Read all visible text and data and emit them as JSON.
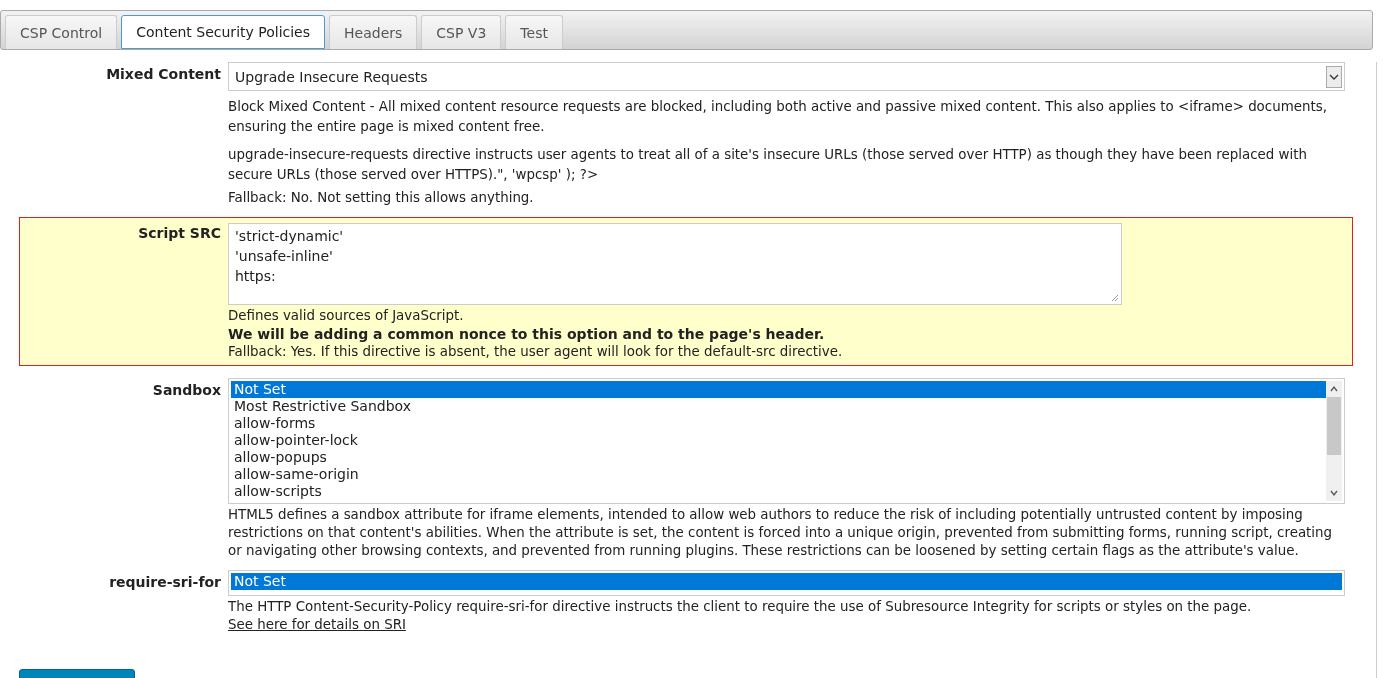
{
  "tabs": [
    {
      "label": "CSP Control",
      "selected": false
    },
    {
      "label": "Content Security Policies",
      "selected": true
    },
    {
      "label": "Headers",
      "selected": false
    },
    {
      "label": "CSP V3",
      "selected": false
    },
    {
      "label": "Test",
      "selected": false
    }
  ],
  "fields": [
    {
      "kind": "select",
      "label": "Mixed Content",
      "highlighted": false,
      "value": "Upgrade Insecure Requests",
      "descriptions": [
        {
          "kind": "paragraph",
          "text": "Block Mixed Content - All mixed content resource requests are blocked, including both active and passive mixed content. This also applies to <iframe> documents, ensuring the entire page is mixed content free."
        },
        {
          "kind": "paragraph",
          "text": "upgrade-insecure-requests directive instructs user agents to treat all of a site's insecure URLs (those served over HTTP) as though they have been replaced with secure URLs (those served over HTTPS).\", 'wpcsp' ); ?>"
        },
        {
          "kind": "plain",
          "text": "Fallback: No. Not setting this allows anything."
        }
      ]
    },
    {
      "kind": "textarea",
      "label": "Script SRC",
      "highlighted": true,
      "lines": [
        "'strict-dynamic'",
        "'unsafe-inline'",
        "https:"
      ],
      "descriptions": [
        {
          "kind": "plain",
          "text": "Defines valid sources of JavaScript."
        },
        {
          "kind": "bold",
          "text": "We will be adding a common nonce to this option and to the page's header."
        },
        {
          "kind": "plain",
          "text": "Fallback: Yes. If this directive is absent, the user agent will look for the default-src directive."
        }
      ]
    },
    {
      "kind": "listbox",
      "label": "Sandbox",
      "highlighted": false,
      "options": [
        {
          "label": "Not Set",
          "selected": true
        },
        {
          "label": "Most Restrictive Sandbox",
          "selected": false
        },
        {
          "label": "allow-forms",
          "selected": false
        },
        {
          "label": "allow-pointer-lock",
          "selected": false
        },
        {
          "label": "allow-popups",
          "selected": false
        },
        {
          "label": "allow-same-origin",
          "selected": false
        },
        {
          "label": "allow-scripts",
          "selected": false
        }
      ],
      "descriptions": [
        {
          "kind": "plain",
          "text": "HTML5 defines a sandbox attribute for iframe elements, intended to allow web authors to reduce the risk of including potentially untrusted content by imposing restrictions on that content's abilities. When the attribute is set, the content is forced into a unique origin, prevented from submitting forms, running script, creating or navigating other browsing contexts, and prevented from running plugins. These restrictions can be loosened by setting certain flags as the attribute's value."
        }
      ]
    },
    {
      "kind": "short-listbox",
      "label": "require-sri-for",
      "highlighted": false,
      "options": [
        {
          "label": "Not Set",
          "selected": true
        }
      ],
      "descriptions": [
        {
          "kind": "plain",
          "text": "The HTTP Content-Security-Policy require-sri-for directive instructs the client to require the use of Subresource Integrity for scripts or styles on the page."
        },
        {
          "kind": "link",
          "text": "See here for details on SRI"
        }
      ]
    }
  ]
}
